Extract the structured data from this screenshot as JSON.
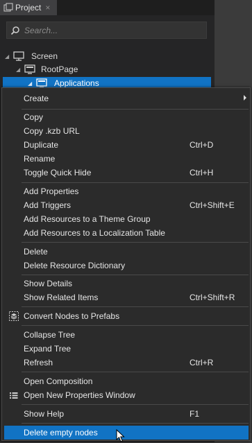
{
  "panel": {
    "tab_title": "Project",
    "tab_close": "×",
    "search_placeholder": "Search..."
  },
  "tree": [
    {
      "label": "Screen",
      "icon": "monitor-icon"
    },
    {
      "label": "RootPage",
      "icon": "page-icon"
    },
    {
      "label": "Applications",
      "icon": "page-icon",
      "selected": true
    }
  ],
  "menu": {
    "items": [
      {
        "label": "Create",
        "submenu": true
      },
      {
        "label": "Copy"
      },
      {
        "label": "Copy .kzb URL"
      },
      {
        "label": "Duplicate",
        "shortcut": "Ctrl+D"
      },
      {
        "label": "Rename"
      },
      {
        "label": "Toggle Quick Hide",
        "shortcut": "Ctrl+H"
      },
      {
        "label": "Add Properties"
      },
      {
        "label": "Add Triggers",
        "shortcut": "Ctrl+Shift+E"
      },
      {
        "label": "Add Resources to a Theme Group"
      },
      {
        "label": "Add Resources to a Localization Table"
      },
      {
        "label": "Delete"
      },
      {
        "label": "Delete Resource Dictionary"
      },
      {
        "label": "Show Details"
      },
      {
        "label": "Show Related Items",
        "shortcut": "Ctrl+Shift+R"
      },
      {
        "label": "Convert Nodes to Prefabs",
        "icon": "prefab-icon"
      },
      {
        "label": "Collapse Tree"
      },
      {
        "label": "Expand Tree"
      },
      {
        "label": "Refresh",
        "shortcut": "Ctrl+R"
      },
      {
        "label": "Open Composition"
      },
      {
        "label": "Open New Properties Window",
        "icon": "list-icon"
      },
      {
        "label": "Show Help",
        "shortcut": "F1"
      },
      {
        "label": "Delete empty nodes",
        "highlighted": true
      }
    ]
  },
  "colors": {
    "accent": "#1173c4",
    "menu_bg": "#2b2b2b",
    "panel_bg": "#252526"
  }
}
